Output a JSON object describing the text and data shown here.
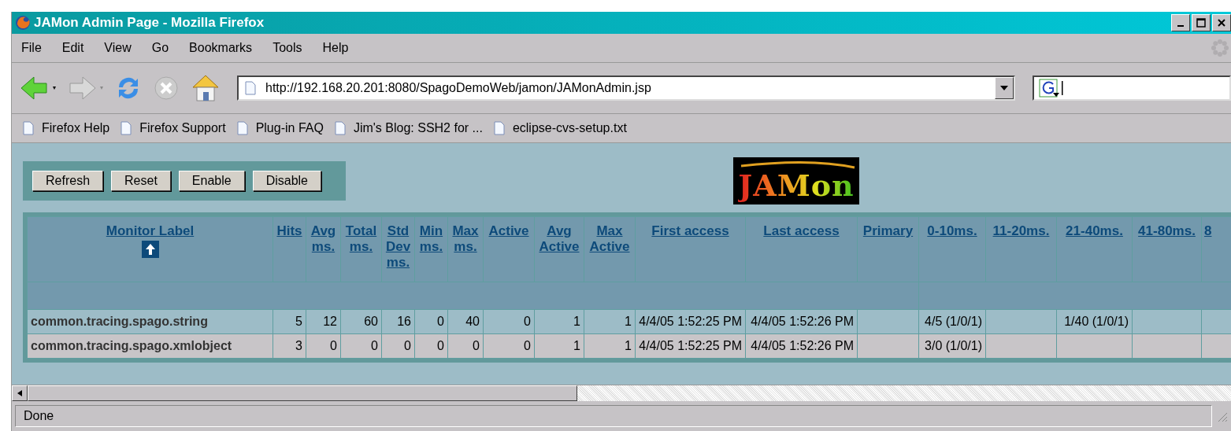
{
  "window": {
    "title": "JAMon Admin Page - Mozilla Firefox"
  },
  "menu": [
    "File",
    "Edit",
    "View",
    "Go",
    "Bookmarks",
    "Tools",
    "Help"
  ],
  "address": {
    "value": "http://192.168.20.201:8080/SpagoDemoWeb/jamon/JAMonAdmin.jsp"
  },
  "bookmarks": [
    "Firefox Help",
    "Firefox Support",
    "Plug-in FAQ",
    "Jim's Blog: SSH2 for ...",
    "eclipse-cvs-setup.txt"
  ],
  "buttons": [
    "Refresh",
    "Reset",
    "Enable",
    "Disable"
  ],
  "logo": "JAMon",
  "table": {
    "columns": [
      {
        "label": "Monitor Label",
        "sorted": true
      },
      {
        "label": "Hits",
        "sorted": false
      },
      {
        "label": "Avg ms.",
        "sorted": false
      },
      {
        "label": "Total ms.",
        "sorted": false
      },
      {
        "label": "Std Dev ms.",
        "sorted": false
      },
      {
        "label": "Min ms.",
        "sorted": false
      },
      {
        "label": "Max ms.",
        "sorted": false
      },
      {
        "label": "Active",
        "sorted": false
      },
      {
        "label": "Avg Active",
        "sorted": false
      },
      {
        "label": "Max Active",
        "sorted": false
      },
      {
        "label": "First access",
        "sorted": false
      },
      {
        "label": "Last access",
        "sorted": false
      },
      {
        "label": "Primary",
        "sorted": false
      },
      {
        "label": "0-10ms.",
        "sorted": false
      },
      {
        "label": "11-20ms.",
        "sorted": false
      },
      {
        "label": "21-40ms.",
        "sorted": false
      },
      {
        "label": "41-80ms.",
        "sorted": false
      },
      {
        "label": "8",
        "sorted": false
      }
    ],
    "rows": [
      [
        "common.tracing.spago.string",
        "5",
        "12",
        "60",
        "16",
        "0",
        "40",
        "0",
        "1",
        "1",
        "4/4/05 1:52:25 PM",
        "4/4/05 1:52:26 PM",
        "",
        "4/5 (1/0/1)",
        "",
        "1/40 (1/0/1)",
        "",
        ""
      ],
      [
        "common.tracing.spago.xmlobject",
        "3",
        "0",
        "0",
        "0",
        "0",
        "0",
        "0",
        "1",
        "1",
        "4/4/05 1:52:25 PM",
        "4/4/05 1:52:26 PM",
        "",
        "3/0 (1/0/1)",
        "",
        "",
        "",
        ""
      ]
    ]
  },
  "status_bar": "Done"
}
